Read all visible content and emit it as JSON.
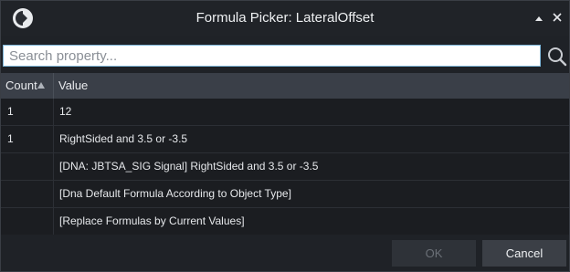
{
  "window": {
    "title": "Formula Picker: LateralOffset",
    "minimize_icon": "caret-up-icon",
    "close_icon": "close-icon",
    "logo_icon": "app-logo-icon"
  },
  "search": {
    "placeholder": "Search property...",
    "value": "",
    "icon": "search-icon"
  },
  "table": {
    "columns": [
      {
        "label": "Count",
        "sort": "ascending"
      },
      {
        "label": "Value"
      }
    ],
    "rows": [
      {
        "count": "1",
        "value": "12"
      },
      {
        "count": "1",
        "value": "RightSided and 3.5 or -3.5"
      },
      {
        "count": "",
        "value": "[DNA: JBTSA_SIG Signal] RightSided and 3.5 or -3.5"
      },
      {
        "count": "",
        "value": "[Dna Default Formula According to Object Type]"
      },
      {
        "count": "",
        "value": "[Replace Formulas by Current Values]"
      }
    ]
  },
  "footer": {
    "ok_label": "OK",
    "ok_enabled": false,
    "cancel_label": "Cancel"
  },
  "colors": {
    "background": "#1f2227",
    "header": "#3a3f48",
    "accent_border": "#7fb6d8"
  }
}
